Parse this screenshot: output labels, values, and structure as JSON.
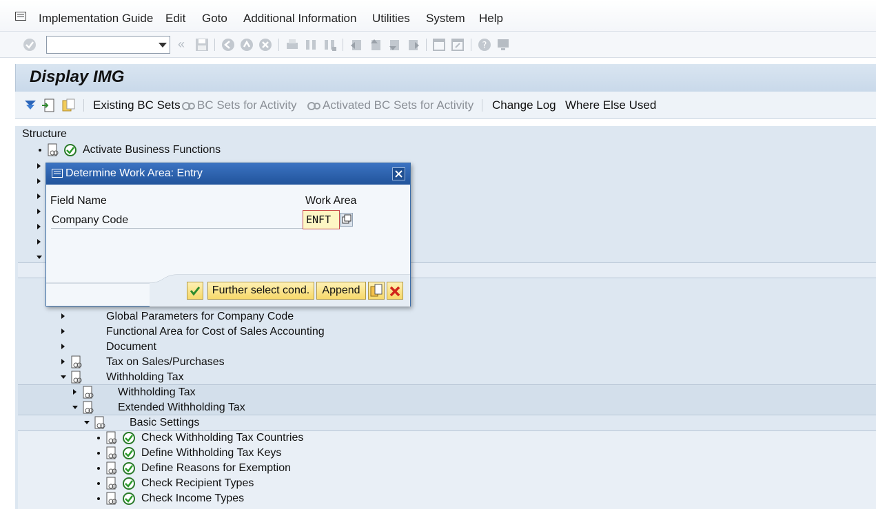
{
  "menu": {
    "items": [
      "Implementation Guide",
      "Edit",
      "Goto",
      "Additional Information",
      "Utilities",
      "System",
      "Help"
    ]
  },
  "toolbar": {
    "command_field_value": ""
  },
  "title": "Display IMG",
  "app_toolbar": {
    "existing_bc_sets": "Existing BC Sets",
    "bc_sets_for_activity": "BC Sets for Activity",
    "activated_bc_sets": "Activated BC Sets for Activity",
    "change_log": "Change Log",
    "where_else_used": "Where Else Used"
  },
  "tree": {
    "header": "Structure",
    "rows": [
      "Activate Business Functions",
      "Global Parameters for Company Code",
      "Functional Area for Cost of Sales Accounting",
      "Document",
      "Tax on Sales/Purchases",
      "Withholding Tax",
      "Withholding Tax",
      "Extended Withholding Tax",
      "Basic Settings",
      "Check Withholding Tax Countries",
      "Define Withholding Tax Keys",
      "Define Reasons for Exemption",
      "Check Recipient Types",
      "Check Income Types"
    ]
  },
  "dialog": {
    "title": "Determine Work Area: Entry",
    "field_name_header": "Field Name",
    "work_area_header": "Work Area",
    "field_label": "Company Code",
    "work_area_value": "ENFT",
    "buttons": {
      "further_select": "Further select cond.",
      "append": "Append"
    }
  },
  "colors": {
    "title_bar": "#21549b",
    "tree_background": "#dde7f1",
    "button_yellow": "#f7d96a",
    "input_highlight": "#fdf6c4"
  }
}
